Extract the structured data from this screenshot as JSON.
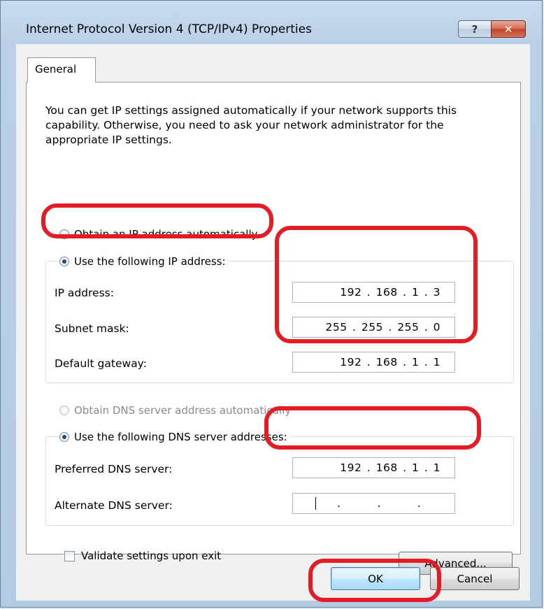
{
  "window": {
    "title": "Internet Protocol Version 4 (TCP/IPv4) Properties",
    "help_glyph": "?",
    "close_glyph": "✕"
  },
  "tabs": [
    {
      "label": "General"
    }
  ],
  "intro_text": "You can get IP settings assigned automatically if your network supports this capability. Otherwise, you need to ask your network administrator for the appropriate IP settings.",
  "ip_mode": {
    "auto_label": "Obtain an IP address automatically",
    "manual_label": "Use the following IP address:",
    "selected": "manual"
  },
  "ip_fields": {
    "ip_label": "IP address:",
    "ip_value": "192 . 168 .  1  .  3",
    "subnet_label": "Subnet mask:",
    "subnet_value": "255 . 255 . 255 .  0",
    "gateway_label": "Default gateway:",
    "gateway_value": "192 . 168 .  1  .  1"
  },
  "dns_mode": {
    "auto_label": "Obtain DNS server address automatically",
    "manual_label": "Use the following DNS server addresses:",
    "selected": "manual"
  },
  "dns_fields": {
    "preferred_label": "Preferred DNS server:",
    "preferred_value": "192 . 168 .  1  .  1",
    "alternate_label": "Alternate DNS server:",
    "alternate_dots": "."
  },
  "validate": {
    "label": "Validate settings upon exit",
    "checked": false
  },
  "buttons": {
    "advanced": "Advanced...",
    "ok": "OK",
    "cancel": "Cancel"
  },
  "colors": {
    "highlight": "#e31d25",
    "accent": "#1c4c86"
  }
}
